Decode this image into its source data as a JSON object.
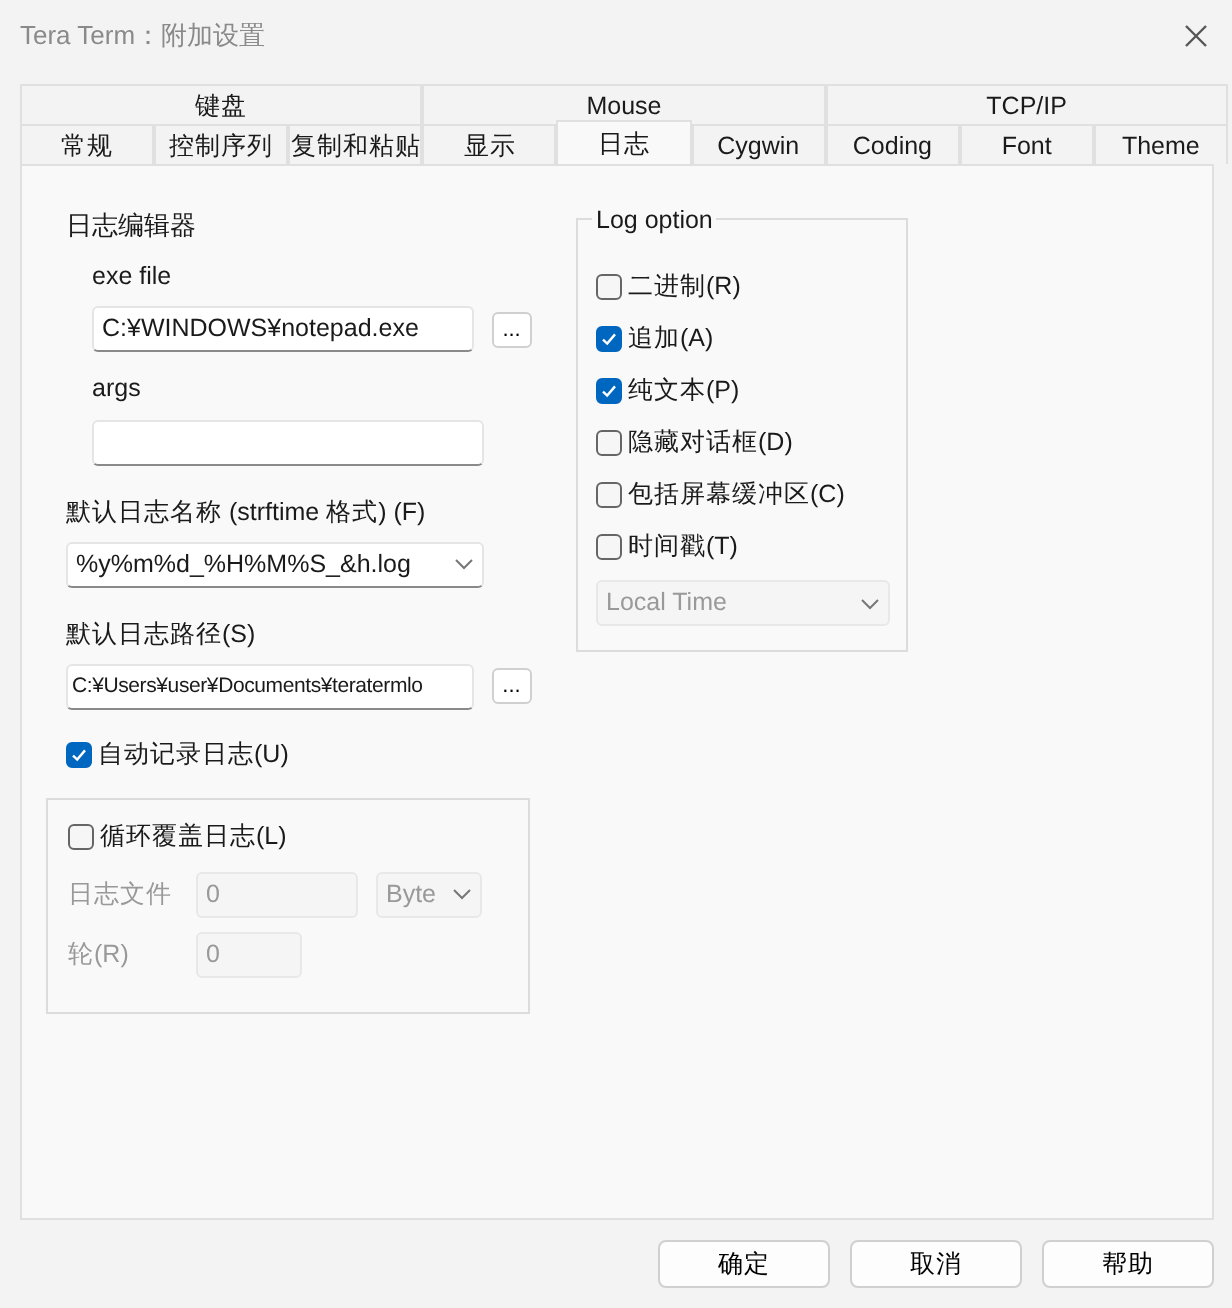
{
  "window": {
    "title": "Tera Term：附加设置"
  },
  "tab_rows": [
    [
      {
        "label": "键盘",
        "selected": false
      },
      {
        "label": "Mouse",
        "selected": false
      },
      {
        "label": "TCP/IP",
        "selected": false
      }
    ],
    [
      {
        "label": "常规",
        "selected": false
      },
      {
        "label": "控制序列",
        "selected": false
      },
      {
        "label": "复制和粘贴",
        "selected": false
      },
      {
        "label": "显示",
        "selected": false
      },
      {
        "label": "日志",
        "selected": true
      },
      {
        "label": "Cygwin",
        "selected": false
      },
      {
        "label": "Coding",
        "selected": false
      },
      {
        "label": "Font",
        "selected": false
      },
      {
        "label": "Theme",
        "selected": false
      }
    ]
  ],
  "log_editor": {
    "heading": "日志编辑器",
    "exe_label": "exe file",
    "exe_value": "C:¥WINDOWS¥notepad.exe",
    "browse": "...",
    "args_label": "args"
  },
  "log_name": {
    "label": "默认日志名称 (strftime 格式) (F)",
    "value": "%y%m%d_%H%M%S_&h.log"
  },
  "log_path": {
    "label": "默认日志路径(S)",
    "value": "C:¥Users¥user¥Documents¥teratermlo",
    "browse": "..."
  },
  "auto_log": {
    "label": "自动记录日志(U)",
    "checked": true
  },
  "rotate": {
    "label": "循环覆盖日志(L)",
    "checked": false,
    "fields": [
      {
        "label": "日志文件",
        "value": "0",
        "unit": "Byte",
        "disabled": true
      },
      {
        "label": "轮(R)",
        "value": "0",
        "disabled": true
      }
    ]
  },
  "log_option": {
    "legend": "Log option",
    "options": [
      {
        "label": "二进制(R)",
        "checked": false
      },
      {
        "label": "追加(A)",
        "checked": true
      },
      {
        "label": "纯文本(P)",
        "checked": true
      },
      {
        "label": "隐藏对话框(D)",
        "checked": false
      },
      {
        "label": "包括屏幕缓冲区(C)",
        "checked": false
      },
      {
        "label": "时间戳(T)",
        "checked": false
      }
    ],
    "timestamp_format": {
      "value": "Local Time",
      "disabled": true
    }
  },
  "buttons": [
    "确定",
    "取消",
    "帮助"
  ]
}
